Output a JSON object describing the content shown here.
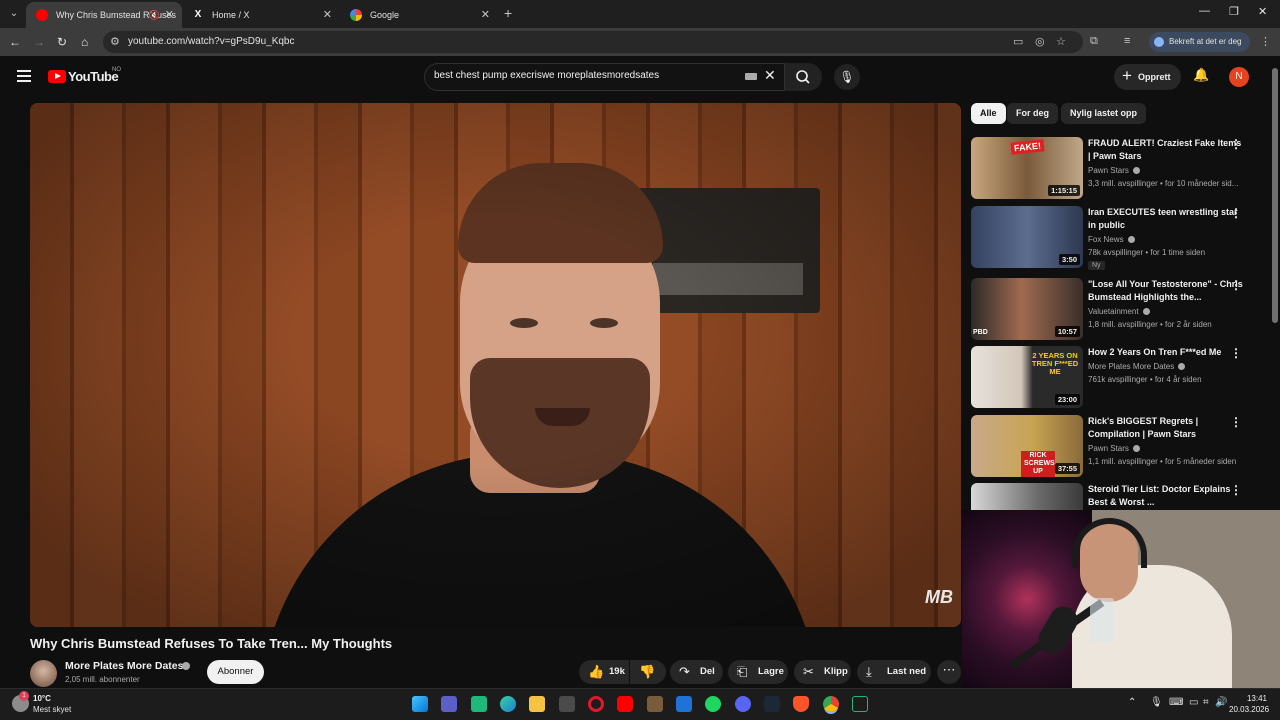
{
  "browser": {
    "tabs": [
      {
        "label": "Why Chris Bumstead Refuses",
        "active": true,
        "favicon_color": "#ff0000"
      },
      {
        "label": "Home / X",
        "active": false,
        "favicon_color": "#ffffff"
      },
      {
        "label": "Google",
        "active": false,
        "favicon_color": "#4285f4"
      }
    ],
    "url": "youtube.com/watch?v=gPsD9u_Kqbc",
    "profile_label": "Bekreft at det er deg"
  },
  "youtube": {
    "logo_text": "YouTube",
    "country_code": "NO",
    "search_query": "best chest pump execriswe moreplatesmoredsates",
    "create_label": "Opprett",
    "avatar_letter": "N",
    "video": {
      "title": "Why Chris Bumstead Refuses To Take Tren... My Thoughts",
      "channel": "More Plates More Dates",
      "subscribers": "2,05 mill. abonnenter",
      "subscribe_label": "Abonner",
      "likes": "19k",
      "share_label": "Del",
      "save_label": "Lagre",
      "clip_label": "Klipp",
      "download_label": "Last ned",
      "watermark": "MB"
    },
    "chips": [
      "Alle",
      "For deg",
      "Nylig lastet opp"
    ],
    "recommendations": [
      {
        "title": "FRAUD ALERT! Craziest Fake Items | Pawn Stars",
        "channel": "Pawn Stars",
        "meta": "3,3 mill. avspillinger • for 10 måneder sid...",
        "duration": "1:15:15",
        "thumb_text": "FAKE!",
        "thumb_color": "#7a5a3a"
      },
      {
        "title": "Iran EXECUTES teen wrestling star in public",
        "channel": "Fox News",
        "meta": "78k avspillinger • for 1 time siden",
        "duration": "3:50",
        "badge": "Ny",
        "thumb_text": "",
        "thumb_color": "#3d4a66"
      },
      {
        "title": "\"Lose All Your Testosterone\" - Chris Bumstead Highlights the...",
        "channel": "Valuetainment",
        "meta": "1,8 mill. avspillinger • for 2 år siden",
        "duration": "10:57",
        "thumb_text": "PBD",
        "thumb_color": "#5a3f33"
      },
      {
        "title": "How 2 Years On Tren F***ed Me",
        "channel": "More Plates More Dates",
        "meta": "761k avspillinger • for 4 år siden",
        "duration": "23:00",
        "thumb_text": "2 YEARS ON TREN F***ED ME",
        "thumb_color": "#d9d4cc"
      },
      {
        "title": "Rick's BIGGEST Regrets | Compilation | Pawn Stars",
        "channel": "Pawn Stars",
        "meta": "1,1 mill. avspillinger • for 5 måneder siden",
        "duration": "37:55",
        "thumb_text": "RICK SCREWS UP",
        "thumb_color": "#9b8560"
      },
      {
        "title": "Steroid Tier List: Doctor Explains Best & Worst ...",
        "channel": "",
        "meta": "",
        "duration": "",
        "thumb_text": "",
        "thumb_color": "#6a6a6a"
      }
    ]
  },
  "taskbar": {
    "temperature": "10°C",
    "condition": "Mest skyet",
    "time": "13:41",
    "date": "20.03.2026"
  }
}
